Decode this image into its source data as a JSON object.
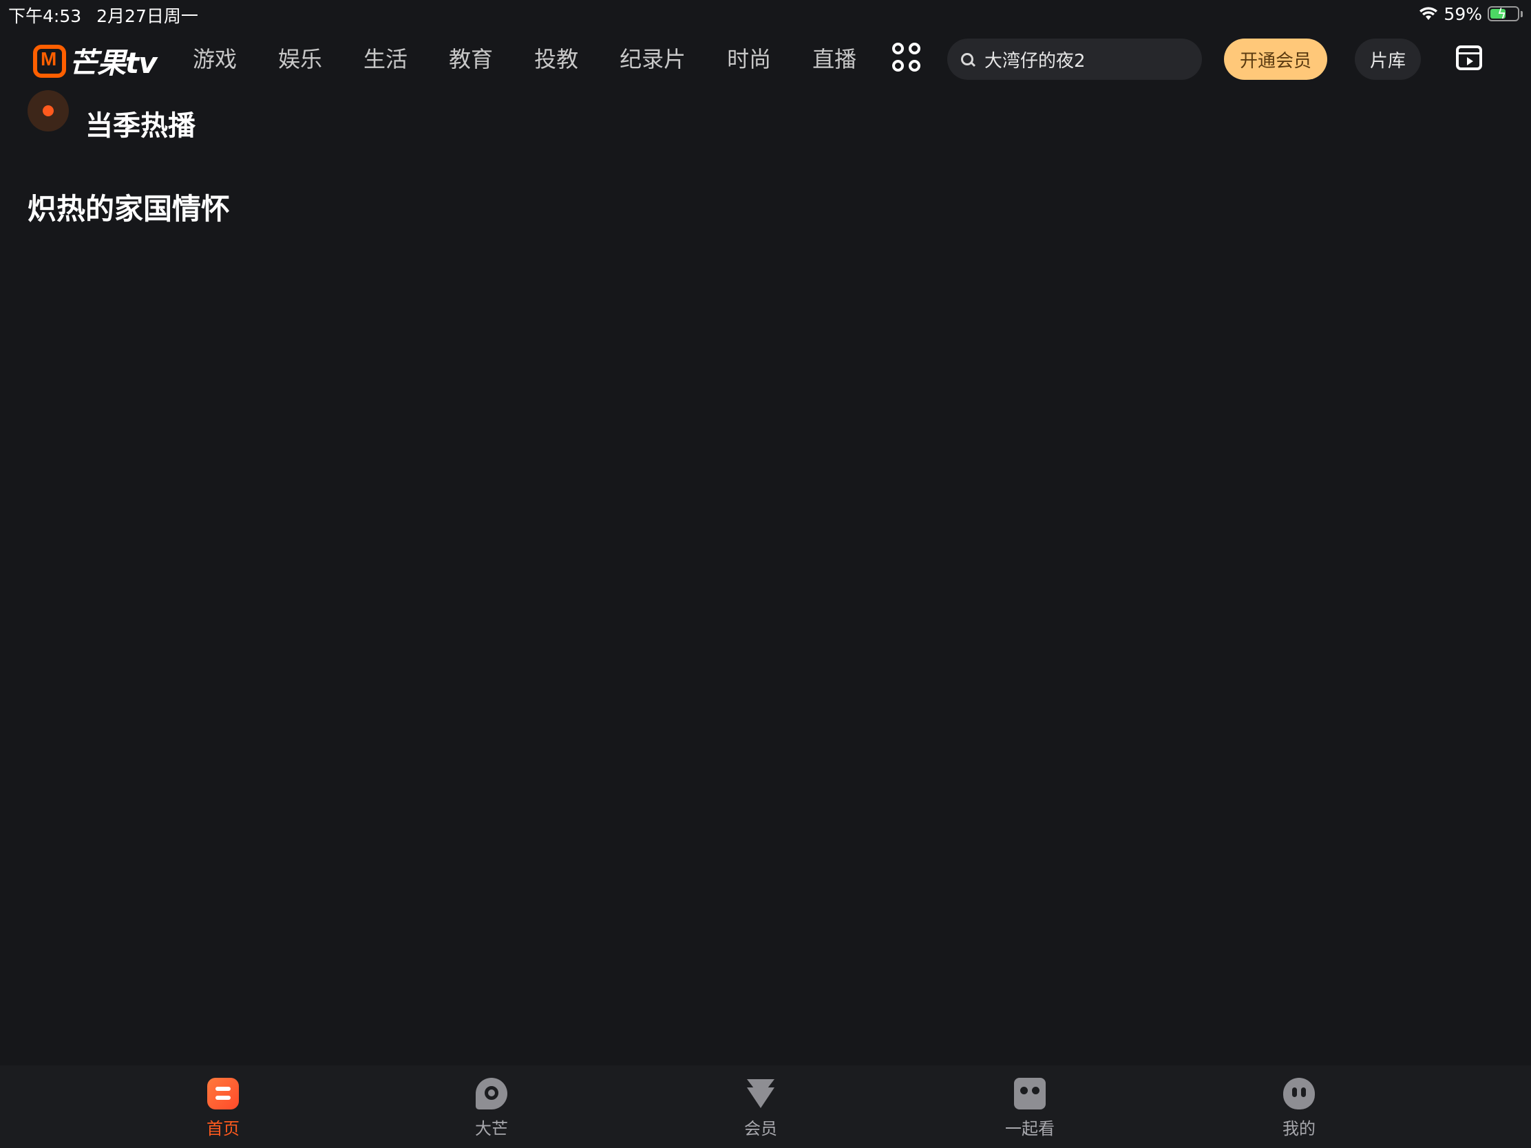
{
  "status_bar": {
    "time": "下午4:53",
    "date": "2月27日周一",
    "battery_text": "59%",
    "battery_level": 0.59
  },
  "brand": {
    "logo_text": "芒果tv",
    "accent_color": "#ff5f00"
  },
  "nav": {
    "tabs": [
      {
        "label": "游戏"
      },
      {
        "label": "娱乐"
      },
      {
        "label": "生活"
      },
      {
        "label": "教育"
      },
      {
        "label": "投教"
      },
      {
        "label": "纪录片"
      },
      {
        "label": "时尚"
      },
      {
        "label": "直播"
      }
    ],
    "more_icon": "grid-icon",
    "search": {
      "icon": "search-icon",
      "text": "大湾仔的夜2"
    },
    "vip_label": "开通会员",
    "library_label": "片库",
    "calendar_icon": "calendar-icon"
  },
  "content": {
    "section_icon": "play-circle-icon",
    "section_title": "当季热播",
    "sub_heading": "炽热的家国情怀"
  },
  "tab_bar": {
    "active_color": "#ff5a1e",
    "items": [
      {
        "label": "首页",
        "icon": "home-icon",
        "active": true
      },
      {
        "label": "大芒",
        "icon": "damang-icon",
        "active": false
      },
      {
        "label": "会员",
        "icon": "vip-icon",
        "active": false
      },
      {
        "label": "一起看",
        "icon": "watch-together-icon",
        "active": false
      },
      {
        "label": "我的",
        "icon": "profile-icon",
        "active": false
      }
    ]
  }
}
